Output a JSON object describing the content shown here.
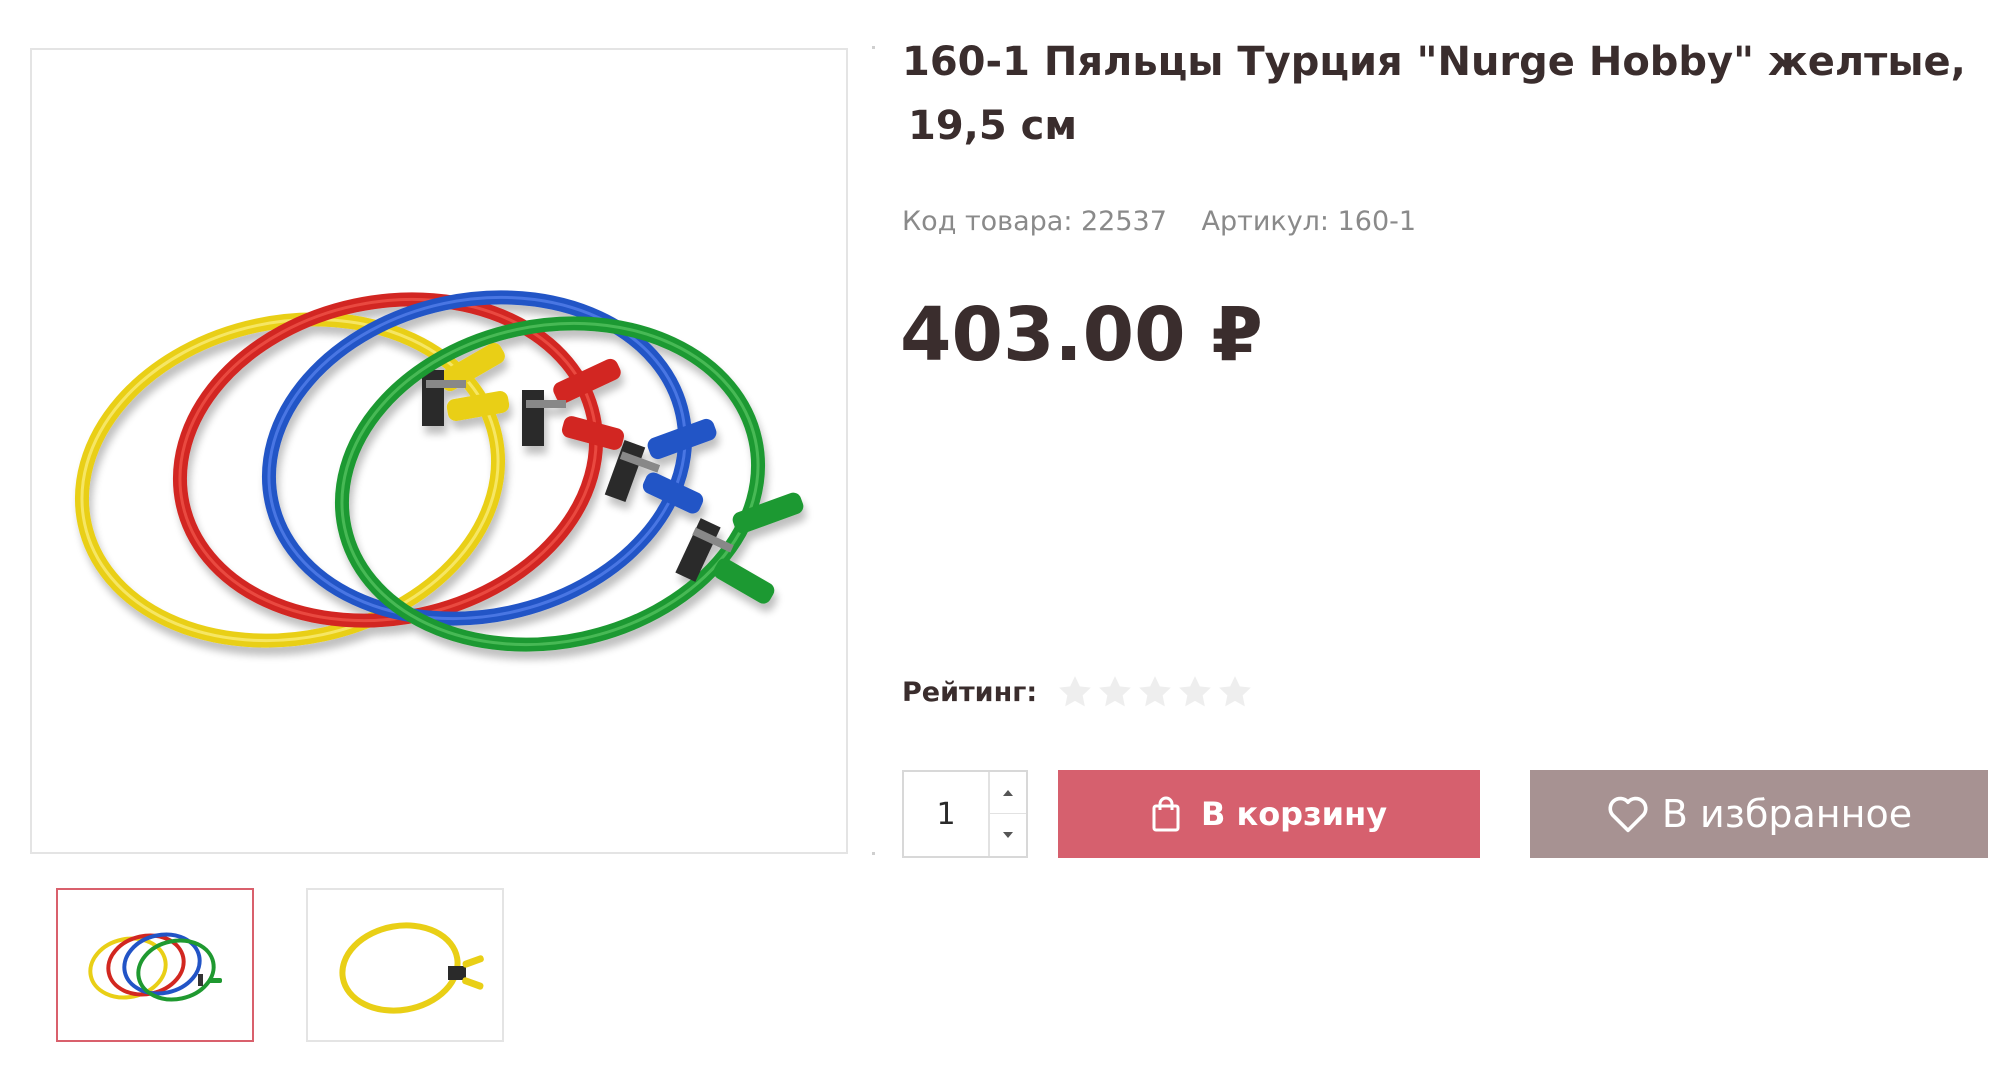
{
  "product": {
    "title_line1": "160-1 Пяльцы Турция \"Nurge Hobby\" желтые,",
    "title_line2": "19,5 см",
    "code_label": "Код товара: 22537",
    "article_label": "Артикул: 160-1",
    "price": "403.00 ₽",
    "rating_label": "Рейтинг:",
    "rating_value": 0,
    "rating_max": 5
  },
  "images": {
    "main_alt": "Пяльцы, набор разноцветных пялец",
    "hoop_colors": [
      "#f2dc1a",
      "#d8251f",
      "#2350c8",
      "#1d9a2a"
    ],
    "thumb1_alt": "Набор пялец",
    "thumb2_alt": "Желтые пяльцы"
  },
  "purchase": {
    "quantity": "1",
    "cart_label": "В корзину",
    "favorite_label": "В избранное"
  },
  "colors": {
    "cart_button": "#d6606e",
    "favorite_button": "#a79292",
    "active_thumb_border": "#d9606c",
    "star_empty": "#eeeeee"
  },
  "icons": {
    "cart": "shopping-bag-icon",
    "favorite": "heart-icon",
    "step_up": "caret-up-icon",
    "step_down": "caret-down-icon",
    "star": "star-icon"
  }
}
